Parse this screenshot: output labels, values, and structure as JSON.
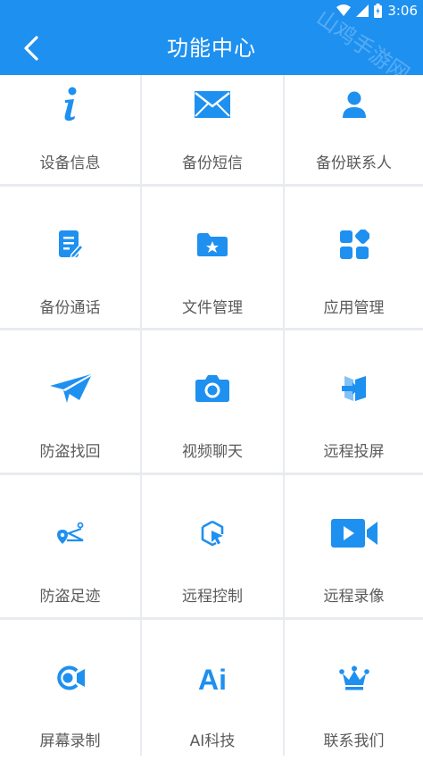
{
  "status_bar": {
    "time": "3:06"
  },
  "header": {
    "title": "功能中心",
    "watermark": "山鸡手游网"
  },
  "colors": {
    "primary": "#1e90f0",
    "icon": "#1e90f0",
    "label": "#5a5a5a",
    "divider": "#e8ebef"
  },
  "features": [
    {
      "label": "设备信息",
      "icon": "info-icon"
    },
    {
      "label": "备份短信",
      "icon": "envelope-icon"
    },
    {
      "label": "备份联系人",
      "icon": "person-icon"
    },
    {
      "label": "备份通话",
      "icon": "document-edit-icon"
    },
    {
      "label": "文件管理",
      "icon": "folder-star-icon"
    },
    {
      "label": "应用管理",
      "icon": "apps-grid-icon"
    },
    {
      "label": "防盗找回",
      "icon": "paper-plane-icon"
    },
    {
      "label": "视频聊天",
      "icon": "camera-icon"
    },
    {
      "label": "远程投屏",
      "icon": "screen-cast-icon"
    },
    {
      "label": "防盗足迹",
      "icon": "location-trail-icon"
    },
    {
      "label": "远程控制",
      "icon": "remote-cursor-icon"
    },
    {
      "label": "远程录像",
      "icon": "video-camera-icon"
    },
    {
      "label": "屏幕录制",
      "icon": "screen-record-icon"
    },
    {
      "label": "AI科技",
      "icon": "ai-text-icon"
    },
    {
      "label": "联系我们",
      "icon": "crown-icon"
    }
  ],
  "ai_icon_text": "Ai"
}
